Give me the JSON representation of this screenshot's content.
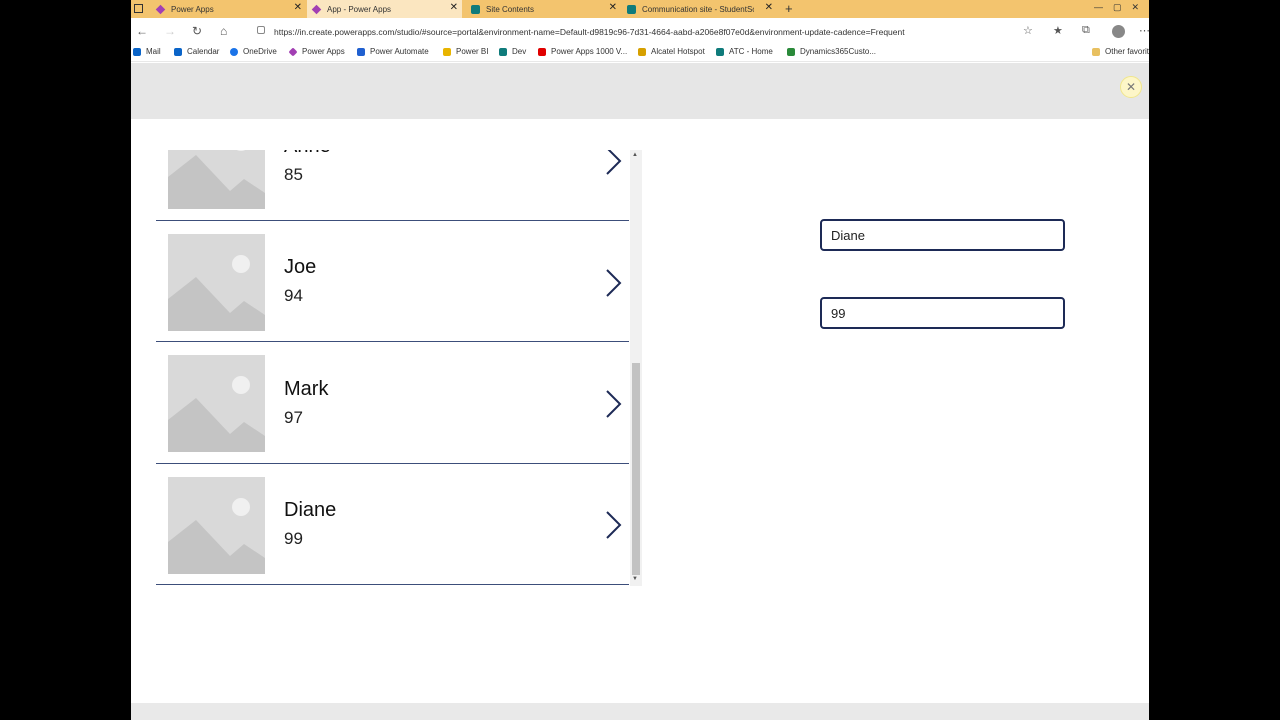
{
  "browser": {
    "tabs": [
      {
        "title": "Power Apps",
        "icon": "powerapps-icon",
        "active": false
      },
      {
        "title": "App - Power Apps",
        "icon": "powerapps-icon",
        "active": true
      },
      {
        "title": "Site Contents",
        "icon": "sharepoint-icon",
        "active": false
      },
      {
        "title": "Communication site - StudentSc",
        "icon": "sharepoint-icon",
        "active": false
      }
    ],
    "url": "https://in.create.powerapps.com/studio/#source=portal&environment-name=Default-d9819c96-7d31-4664-aabd-a206e8f07e0d&environment-update-cadence=Frequent",
    "favorites": [
      {
        "label": "Mail",
        "color": "#0a64c8"
      },
      {
        "label": "Calendar",
        "color": "#0a64c8"
      },
      {
        "label": "OneDrive",
        "color": "#1a73e8"
      },
      {
        "label": "Power Apps",
        "color": "#a23fb3"
      },
      {
        "label": "Power Automate",
        "color": "#2060d0"
      },
      {
        "label": "Power BI",
        "color": "#e8b400"
      },
      {
        "label": "Dev",
        "color": "#0f7b7b"
      },
      {
        "label": "Power Apps 1000 V...",
        "color": "#e00000"
      },
      {
        "label": "Alcatel Hotspot",
        "color": "#d6a000"
      },
      {
        "label": "ATC - Home",
        "color": "#0f7b7b"
      },
      {
        "label": "Dynamics365Custo...",
        "color": "#2a8a3a"
      }
    ],
    "other_favorites": "Other favorit"
  },
  "gallery": {
    "items": [
      {
        "name": "Anne",
        "score": "85"
      },
      {
        "name": "Joe",
        "score": "94"
      },
      {
        "name": "Mark",
        "score": "97"
      },
      {
        "name": "Diane",
        "score": "99"
      }
    ]
  },
  "form": {
    "name_value": "Diane",
    "score_value": "99"
  }
}
